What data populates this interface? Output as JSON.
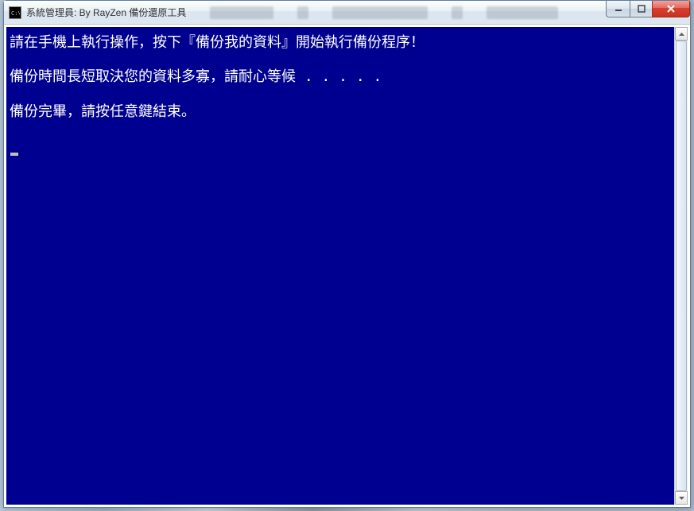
{
  "window": {
    "title": "系統管理員: By RayZen 備份還原工具"
  },
  "console": {
    "lines": [
      "請在手機上執行操作，按下『備份我的資料』開始執行備份程序！",
      "備份時間長短取決您的資料多寡，請耐心等候 . . . . .",
      "備份完畢，請按任意鍵結束。"
    ]
  }
}
